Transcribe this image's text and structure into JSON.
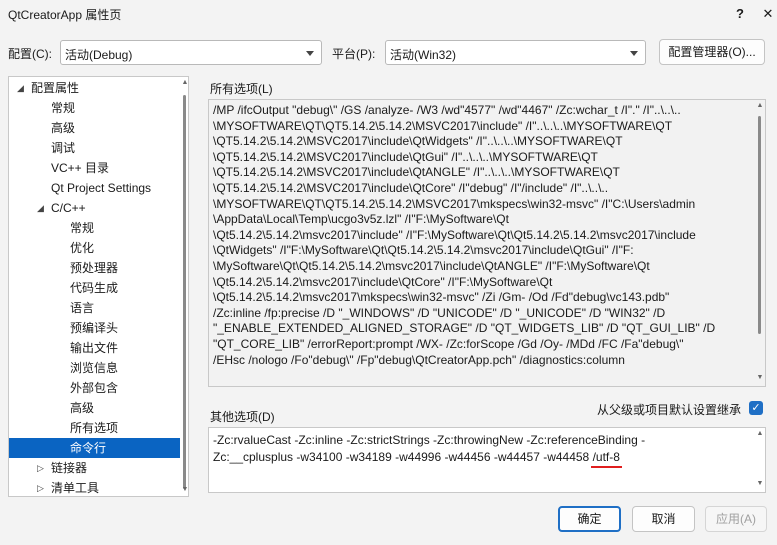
{
  "window": {
    "title": "QtCreatorApp 属性页",
    "help_label": "?",
    "close_label": "✕"
  },
  "toolbar": {
    "config_label": "配置(C):",
    "config_value": "活动(Debug)",
    "platform_label": "平台(P):",
    "platform_value": "活动(Win32)",
    "config_manager_label": "配置管理器(O)..."
  },
  "tree": {
    "items": [
      {
        "label": "配置属性",
        "level": 0,
        "expander": "expanded"
      },
      {
        "label": "常规",
        "level": 1
      },
      {
        "label": "高级",
        "level": 1
      },
      {
        "label": "调试",
        "level": 1
      },
      {
        "label": "VC++ 目录",
        "level": 1
      },
      {
        "label": "Qt Project Settings",
        "level": 1
      },
      {
        "label": "C/C++",
        "level": 1,
        "expander": "expanded"
      },
      {
        "label": "常规",
        "level": 2
      },
      {
        "label": "优化",
        "level": 2
      },
      {
        "label": "预处理器",
        "level": 2
      },
      {
        "label": "代码生成",
        "level": 2
      },
      {
        "label": "语言",
        "level": 2
      },
      {
        "label": "预编译头",
        "level": 2
      },
      {
        "label": "输出文件",
        "level": 2
      },
      {
        "label": "浏览信息",
        "level": 2
      },
      {
        "label": "外部包含",
        "level": 2
      },
      {
        "label": "高级",
        "level": 2
      },
      {
        "label": "所有选项",
        "level": 2
      },
      {
        "label": "命令行",
        "level": 2,
        "selected": true
      },
      {
        "label": "链接器",
        "level": 1,
        "expander": "collapsed"
      },
      {
        "label": "清单工具",
        "level": 1,
        "expander": "collapsed"
      }
    ]
  },
  "all_options": {
    "label": "所有选项(L)",
    "lines": [
      "/MP /ifcOutput \"debug\\\" /GS /analyze- /W3 /wd\"4577\" /wd\"4467\" /Zc:wchar_t /I\".\" /I\"..\\..\\..",
      "\\MYSOFTWARE\\QT\\QT5.14.2\\5.14.2\\MSVC2017\\include\" /I\"..\\..\\..\\MYSOFTWARE\\QT",
      "\\QT5.14.2\\5.14.2\\MSVC2017\\include\\QtWidgets\" /I\"..\\..\\..\\MYSOFTWARE\\QT",
      "\\QT5.14.2\\5.14.2\\MSVC2017\\include\\QtGui\" /I\"..\\..\\..\\MYSOFTWARE\\QT",
      "\\QT5.14.2\\5.14.2\\MSVC2017\\include\\QtANGLE\" /I\"..\\..\\..\\MYSOFTWARE\\QT",
      "\\QT5.14.2\\5.14.2\\MSVC2017\\include\\QtCore\" /I\"debug\" /I\"/include\" /I\"..\\..\\..",
      "\\MYSOFTWARE\\QT\\QT5.14.2\\5.14.2\\MSVC2017\\mkspecs\\win32-msvc\" /I\"C:\\Users\\admin",
      "\\AppData\\Local\\Temp\\ucgo3v5z.lzl\" /I\"F:\\MySoftware\\Qt",
      "\\Qt5.14.2\\5.14.2\\msvc2017\\include\" /I\"F:\\MySoftware\\Qt\\Qt5.14.2\\5.14.2\\msvc2017\\include",
      "\\QtWidgets\" /I\"F:\\MySoftware\\Qt\\Qt5.14.2\\5.14.2\\msvc2017\\include\\QtGui\" /I\"F:",
      "\\MySoftware\\Qt\\Qt5.14.2\\5.14.2\\msvc2017\\include\\QtANGLE\" /I\"F:\\MySoftware\\Qt",
      "\\Qt5.14.2\\5.14.2\\msvc2017\\include\\QtCore\" /I\"F:\\MySoftware\\Qt",
      "\\Qt5.14.2\\5.14.2\\msvc2017\\mkspecs\\win32-msvc\" /Zi /Gm- /Od /Fd\"debug\\vc143.pdb\"",
      "/Zc:inline /fp:precise /D \"_WINDOWS\" /D \"UNICODE\" /D \"_UNICODE\" /D \"WIN32\" /D",
      "\"_ENABLE_EXTENDED_ALIGNED_STORAGE\" /D \"QT_WIDGETS_LIB\" /D \"QT_GUI_LIB\" /D",
      "\"QT_CORE_LIB\" /errorReport:prompt /WX- /Zc:forScope /Gd /Oy- /MDd /FC /Fa\"debug\\\"",
      "/EHsc /nologo /Fo\"debug\\\" /Fp\"debug\\QtCreatorApp.pch\" /diagnostics:column"
    ]
  },
  "other_options": {
    "label": "其他选项(D)",
    "inherit_label": "从父级或项目默认设置继承",
    "inherit_checked": true,
    "line1": "-Zc:rvalueCast -Zc:inline -Zc:strictStrings -Zc:throwingNew -Zc:referenceBinding -",
    "line2": "Zc:__cplusplus -w34100 -w34189 -w44996 -w44456 -w44457 -w44458 ",
    "highlight": "/utf-8"
  },
  "buttons": {
    "ok": "确定",
    "cancel": "取消",
    "apply": "应用(A)"
  }
}
